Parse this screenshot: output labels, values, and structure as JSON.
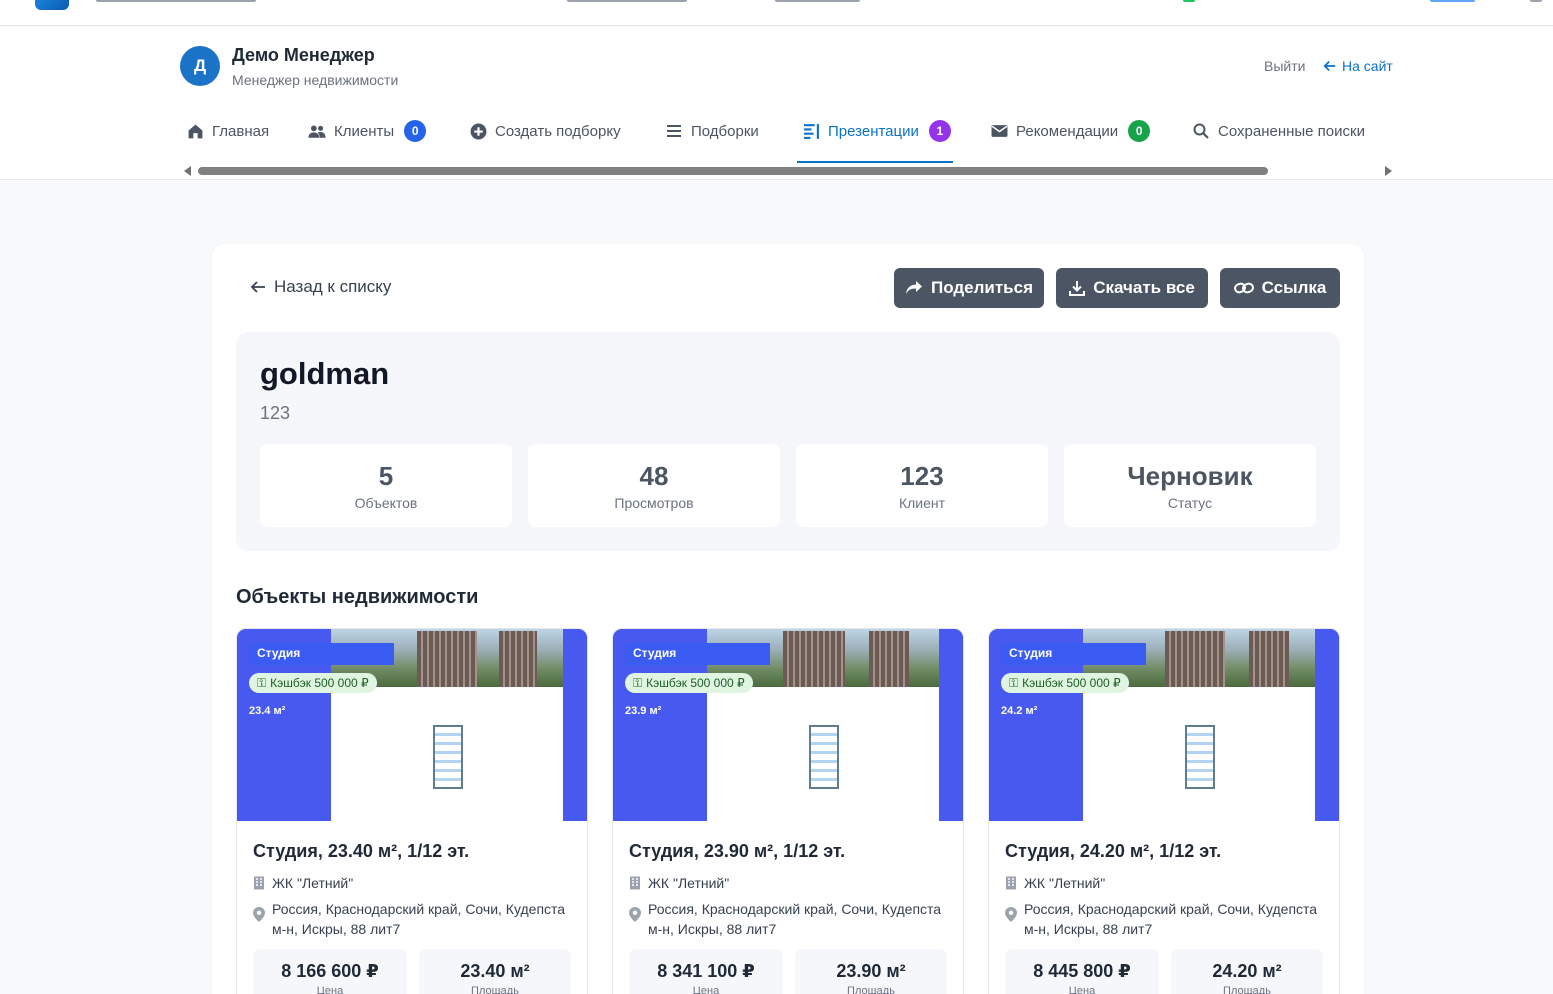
{
  "user": {
    "initial": "Д",
    "name": "Демо Менеджер",
    "role": "Менеджер недвижимости"
  },
  "header_links": {
    "logout": "Выйти",
    "to_site": "На сайт"
  },
  "nav": {
    "items": [
      {
        "label": "Главная",
        "icon": "home-icon"
      },
      {
        "label": "Клиенты",
        "icon": "users-icon",
        "badge": "0",
        "badge_color": "#2563eb"
      },
      {
        "label": "Создать подборку",
        "icon": "plus-circle-icon"
      },
      {
        "label": "Подборки",
        "icon": "list-icon"
      },
      {
        "label": "Презентации",
        "icon": "presentation-icon",
        "badge": "1",
        "badge_color": "#9333ea",
        "active": true
      },
      {
        "label": "Рекомендации",
        "icon": "envelope-icon",
        "badge": "0",
        "badge_color": "#16a34a"
      },
      {
        "label": "Сохраненные поиски",
        "icon": "search-icon"
      }
    ]
  },
  "toolbar": {
    "back": "Назад к списку",
    "share": "Поделиться",
    "download": "Скачать все",
    "link": "Ссылка"
  },
  "presentation": {
    "title": "goldman",
    "subtitle": "123",
    "stats": [
      {
        "value": "5",
        "label": "Объектов"
      },
      {
        "value": "48",
        "label": "Просмотров"
      },
      {
        "value": "123",
        "label": "Клиент"
      },
      {
        "value": "Черновик",
        "label": "Статус"
      }
    ]
  },
  "section_title": "Объекты недвижимости",
  "properties": [
    {
      "image_type": "Студия",
      "image_cashback": "Кэшбэк 500 000 ₽",
      "image_area": "23.4 м²",
      "title": "Студия, 23.40 м², 1/12 эт.",
      "complex": "ЖК \"Летний\"",
      "address": "Россия, Краснодарский край, Сочи, Кудепста м-н, Искры, 88 лит7",
      "price": "8 166 600 ₽",
      "price_label": "Цена",
      "area": "23.40 м²",
      "area_label": "Площадь"
    },
    {
      "image_type": "Студия",
      "image_cashback": "Кэшбэк 500 000 ₽",
      "image_area": "23.9 м²",
      "title": "Студия, 23.90 м², 1/12 эт.",
      "complex": "ЖК \"Летний\"",
      "address": "Россия, Краснодарский край, Сочи, Кудепста м-н, Искры, 88 лит7",
      "price": "8 341 100 ₽",
      "price_label": "Цена",
      "area": "23.90 м²",
      "area_label": "Площадь"
    },
    {
      "image_type": "Студия",
      "image_cashback": "Кэшбэк 500 000 ₽",
      "image_area": "24.2 м²",
      "title": "Студия, 24.20 м², 1/12 эт.",
      "complex": "ЖК \"Летний\"",
      "address": "Россия, Краснодарский край, Сочи, Кудепста м-н, Искры, 88 лит7",
      "price": "8 445 800 ₽",
      "price_label": "Цена",
      "area": "24.20 м²",
      "area_label": "Площадь"
    }
  ],
  "colors": {
    "accent": "#0b72c9",
    "button_dark": "#4b5563",
    "image_blue": "#4759ee",
    "cashback_bg": "#dff5e1"
  }
}
